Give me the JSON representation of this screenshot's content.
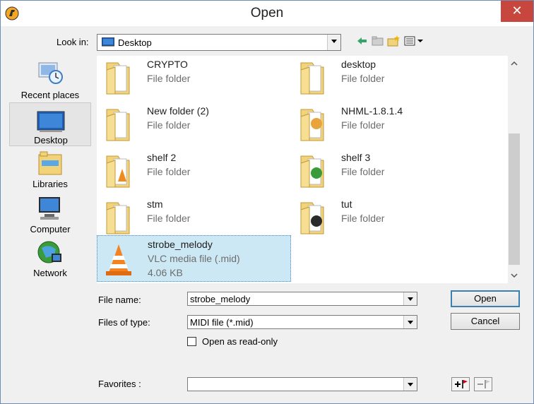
{
  "window": {
    "title": "Open",
    "close_glyph": "✕"
  },
  "look_in": {
    "label": "Look in:",
    "value": "Desktop",
    "icon": "desktop-icon"
  },
  "toolbar": {
    "icons": [
      "back-arrow-icon",
      "up-folder-icon",
      "new-folder-icon",
      "view-menu-icon"
    ]
  },
  "places": [
    {
      "label": "Recent places",
      "icon": "recent-places-icon"
    },
    {
      "label": "Desktop",
      "icon": "desktop-icon"
    },
    {
      "label": "Libraries",
      "icon": "libraries-icon"
    },
    {
      "label": "Computer",
      "icon": "computer-icon"
    },
    {
      "label": "Network",
      "icon": "network-icon"
    }
  ],
  "files": [
    {
      "name": "CRYPTO",
      "type": "File folder"
    },
    {
      "name": "desktop",
      "type": "File folder"
    },
    {
      "name": "New folder (2)",
      "type": "File folder"
    },
    {
      "name": "NHML-1.8.1.4",
      "type": "File folder"
    },
    {
      "name": "shelf 2",
      "type": "File folder"
    },
    {
      "name": "shelf 3",
      "type": "File folder"
    },
    {
      "name": "stm",
      "type": "File folder"
    },
    {
      "name": "tut",
      "type": "File folder"
    },
    {
      "name": "strobe_melody",
      "type": "VLC media file (.mid)",
      "size": "4.06 KB"
    }
  ],
  "file_name": {
    "label": "File name:",
    "value": "strobe_melody"
  },
  "files_of_type": {
    "label": "Files of type:",
    "value": "MIDI file (*.mid)"
  },
  "read_only": {
    "label": "Open as read-only",
    "checked": false
  },
  "favorites": {
    "label": "Favorites :",
    "value": ""
  },
  "buttons": {
    "open": "Open",
    "cancel": "Cancel"
  },
  "colors": {
    "selection": "#cce8f4",
    "close": "#c7463d",
    "folder": "#f2d37a"
  }
}
